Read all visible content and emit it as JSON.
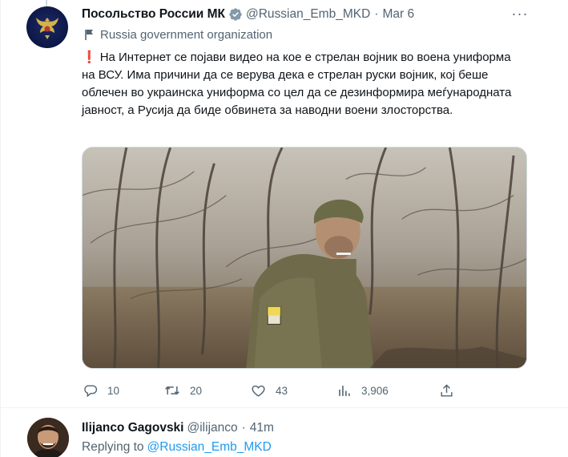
{
  "tweet": {
    "author_name": "Посольство России МК",
    "handle": "@Russian_Emb_MKD",
    "separator": "·",
    "time": "Mar 6",
    "more_label": "···",
    "affiliation": "Russia government organization",
    "exclamation": "❗",
    "text": "На Интернет се појави видео на кое е стрелан војник во воена униформа на ВСУ. Има причини да се верува дека е стрелан руски војник, кој беше облечен во украинска униформа со цел да се дезинформира меѓународната јавност, а Русија да биде обвинета за наводни воени злосторства.",
    "stats": {
      "replies": "10",
      "retweets": "20",
      "likes": "43",
      "views": "3,906"
    },
    "icons": {
      "verified": "verified-badge-icon",
      "affiliation": "flag-icon",
      "reply": "reply-icon",
      "retweet": "retweet-icon",
      "like": "heart-icon",
      "views": "views-icon",
      "share": "share-icon"
    },
    "colors": {
      "verified_badge": "#829aab",
      "mention_link": "#1d9bf0",
      "secondary_text": "#536471"
    }
  },
  "reply": {
    "author_name": "Ilijanco Gagovski",
    "handle": "@ilijanco",
    "separator": "·",
    "time": "41m",
    "replying_label": "Replying to",
    "replying_to": "@Russian_Emb_MKD"
  }
}
